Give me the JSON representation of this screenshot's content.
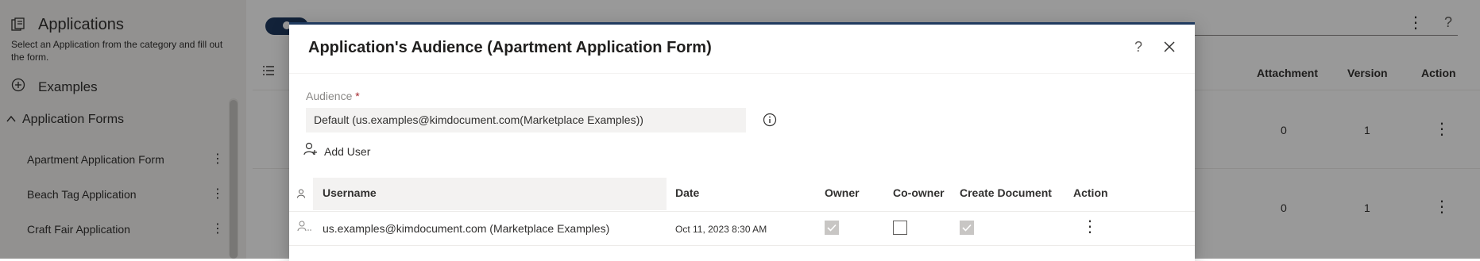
{
  "sidebar": {
    "title": "Applications",
    "description": "Select an Application from the category and fill out the form.",
    "examples_label": "Examples",
    "forms_section_label": "Application Forms",
    "forms": [
      {
        "label": "Apartment Application Form"
      },
      {
        "label": "Beach Tag Application"
      },
      {
        "label": "Craft Fair Application"
      }
    ]
  },
  "main_table": {
    "headers": {
      "attachment": "Attachment",
      "version": "Version",
      "action": "Action"
    },
    "rows": [
      {
        "attachment": "0",
        "version": "1"
      },
      {
        "attachment": "0",
        "version": "1"
      }
    ]
  },
  "dialog": {
    "title": "Application's Audience (Apartment Application Form)",
    "audience_label": "Audience",
    "required_marker": "*",
    "audience_value": "Default (us.examples@kimdocument.com(Marketplace Examples))",
    "add_user_label": "Add User",
    "table": {
      "headers": {
        "username": "Username",
        "date": "Date",
        "owner": "Owner",
        "coowner": "Co-owner",
        "create_document": "Create Document",
        "action": "Action"
      },
      "rows": [
        {
          "username": "us.examples@kimdocument.com (Marketplace Examples)",
          "date": "Oct 11, 2023 8:30 AM",
          "owner": true,
          "coowner": false,
          "create_document": true
        }
      ]
    }
  },
  "icons": {
    "more": "⋮",
    "help": "?",
    "close": "✕"
  },
  "colors": {
    "accent": "#1f3a5f",
    "required": "#a4262c",
    "field_bg": "#f3f2f1"
  }
}
